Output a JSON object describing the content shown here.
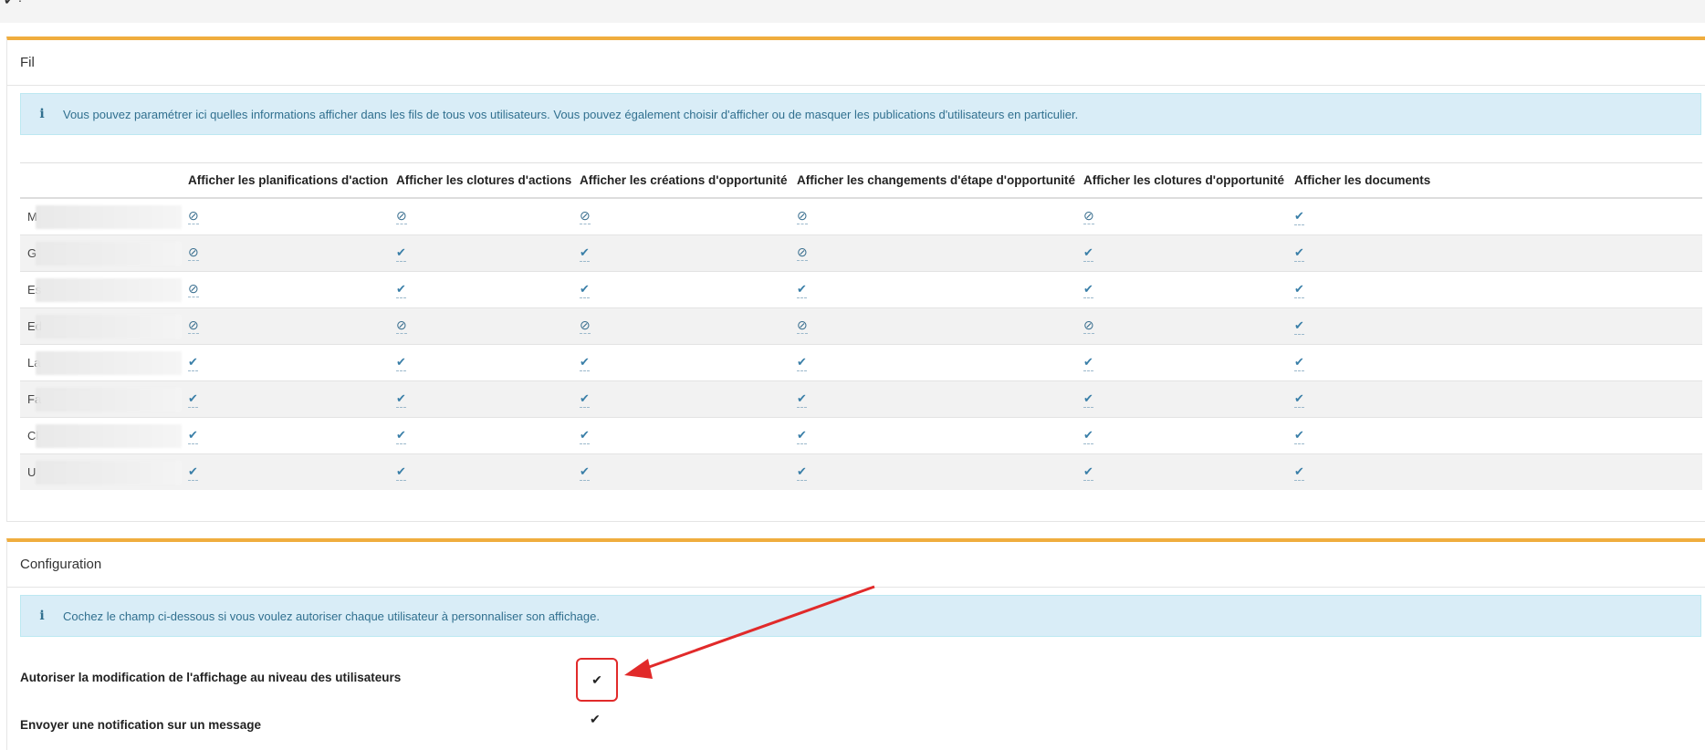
{
  "panels": {
    "fil": {
      "title": "Fil",
      "info": "Vous pouvez paramétrer ici quelles informations afficher dans les fils de tous vos utilisateurs. Vous pouvez également choisir d'afficher ou de masquer les publications d'utilisateurs en particulier.",
      "columns": [
        "",
        "Afficher les planifications d'action",
        "Afficher les clotures d'actions",
        "Afficher les créations d'opportunité",
        "Afficher les changements d'étape d'opportunité",
        "Afficher les clotures d'opportunité",
        "Afficher les documents"
      ],
      "rows": [
        {
          "initial": "M",
          "values": [
            "ban",
            "ban",
            "ban",
            "ban",
            "ban",
            "check"
          ]
        },
        {
          "initial": "G",
          "values": [
            "ban",
            "check",
            "check",
            "ban",
            "check",
            "check"
          ]
        },
        {
          "initial": "Es",
          "values": [
            "ban",
            "check",
            "check",
            "check",
            "check",
            "check"
          ]
        },
        {
          "initial": "Ed",
          "values": [
            "ban",
            "ban",
            "ban",
            "ban",
            "ban",
            "check"
          ]
        },
        {
          "initial": "La",
          "values": [
            "check",
            "check",
            "check",
            "check",
            "check",
            "check"
          ]
        },
        {
          "initial": "Fa",
          "values": [
            "check",
            "check",
            "check",
            "check",
            "check",
            "check"
          ]
        },
        {
          "initial": "Cl",
          "values": [
            "check",
            "check",
            "check",
            "check",
            "check",
            "check"
          ]
        },
        {
          "initial": "U",
          "values": [
            "check",
            "check",
            "check",
            "check",
            "check",
            "check"
          ]
        }
      ]
    },
    "config": {
      "title": "Configuration",
      "info": "Cochez le champ ci-dessous si vous voulez autoriser chaque utilisateur à personnaliser son affichage.",
      "fields": [
        {
          "label": "Autoriser la modification de l'affichage au niveau des utilisateurs",
          "checked": true
        },
        {
          "label": "Envoyer une notification sur un message",
          "checked": true
        }
      ]
    }
  },
  "icons": {
    "info": "info-icon",
    "check": "checkmark-icon",
    "ban": "ban-icon"
  },
  "colors": {
    "accent": "#f0ad3e",
    "info_bg": "#d9edf7",
    "info_text": "#31708f",
    "annotation": "#e12a2a"
  }
}
